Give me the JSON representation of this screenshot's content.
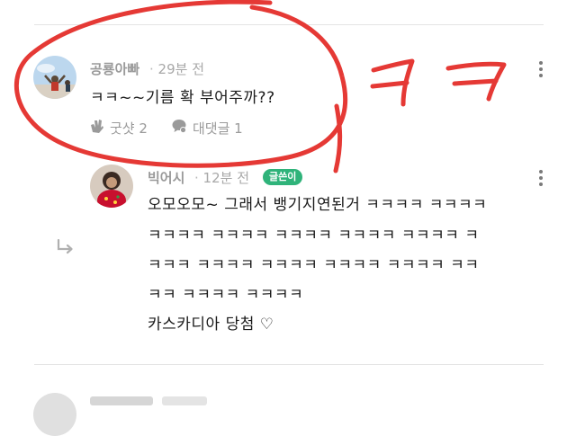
{
  "comment": {
    "author": "공룡아빠",
    "time": "29분 전",
    "text": "ㅋㅋ~~기름 확 부어주까??",
    "like_label": "굿샷 2",
    "reply_label": "대댓글 1"
  },
  "reply": {
    "author": "빅어시",
    "time": "12분 전",
    "badge": "글쓴이",
    "lines": [
      "오모오모~ 그래서 뱅기지연된거 ㅋㅋㅋㅋ ㅋㅋㅋㅋ",
      "ㅋㅋㅋㅋ ㅋㅋㅋㅋ ㅋㅋㅋㅋ ㅋㅋㅋㅋ ㅋㅋㅋㅋ ㅋ",
      "ㅋㅋㅋ ㅋㅋㅋㅋ ㅋㅋㅋㅋ ㅋㅋㅋㅋ ㅋㅋㅋㅋ ㅋㅋ",
      "ㅋㅋ ㅋㅋㅋㅋ ㅋㅋㅋㅋ",
      "카스카디아 당첨 ♡"
    ]
  },
  "icons": {
    "like": "clap-icon",
    "reply": "speech-bubble-icon",
    "more": "more-vertical-icon",
    "reply_indicator": "reply-arrow-icon"
  },
  "colors": {
    "annotation": "#e53935",
    "badge": "#2fb37a",
    "meta_text": "#9a9a9a"
  }
}
